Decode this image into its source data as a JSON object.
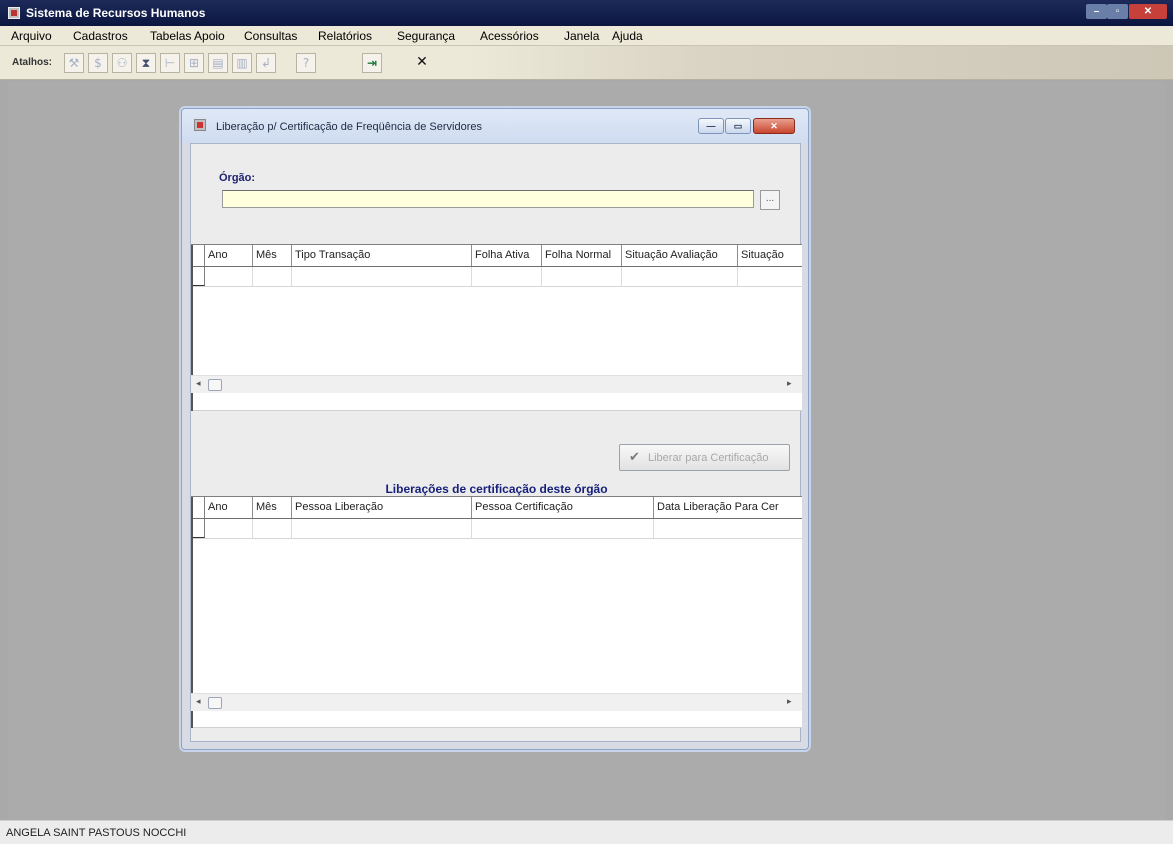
{
  "app": {
    "title": "Sistema de Recursos Humanos",
    "icon": "app-icon"
  },
  "menu": [
    "Arquivo",
    "Cadastros",
    "Tabelas Apoio",
    "Consultas",
    "Relatórios",
    "Segurança",
    "Acessórios",
    "Janela",
    "Ajuda"
  ],
  "toolbar": {
    "label": "Atalhos:",
    "buttons": [
      {
        "icon": "tools-icon",
        "glyph": "⚒"
      },
      {
        "icon": "dollar-icon",
        "glyph": "$"
      },
      {
        "icon": "people-icon",
        "glyph": "⚇"
      },
      {
        "icon": "hourglass-icon",
        "glyph": "⧗"
      },
      {
        "icon": "tree-icon",
        "glyph": "⊢"
      },
      {
        "icon": "org-chart-icon",
        "glyph": "⊞"
      },
      {
        "icon": "document-icon",
        "glyph": "▤"
      },
      {
        "icon": "chart-icon",
        "glyph": "▥"
      },
      {
        "icon": "return-icon",
        "glyph": "↲"
      },
      {
        "icon": "help-icon",
        "glyph": "?"
      },
      {
        "icon": "exit-door-icon",
        "glyph": "⇥"
      },
      {
        "icon": "close-icon",
        "glyph": "✕"
      }
    ]
  },
  "dialog": {
    "title": "Liberação p/ Certificação de Freqüência de Servidores",
    "orgao_label": "Órgão:",
    "orgao_value": "",
    "lookup_label": "...",
    "top_grid": {
      "columns": [
        "Ano",
        "Mês",
        "Tipo Transação",
        "Folha Ativa",
        "Folha Normal",
        "Situação Avaliação",
        "Situação"
      ]
    },
    "liberar_button": "Liberar para Certificação",
    "section_title": "Liberações de certificação deste órgão",
    "bottom_grid": {
      "columns": [
        "Ano",
        "Mês",
        "Pessoa Liberação",
        "Pessoa Certificação",
        "Data Liberação Para Cer"
      ]
    }
  },
  "status": {
    "user": "ANGELA SAINT PASTOUS NOCCHI"
  },
  "colors": {
    "titlebar": "#0b1640",
    "workspace": "#ababab",
    "input_bg": "#ffffdd",
    "section_title": "#17207a"
  }
}
